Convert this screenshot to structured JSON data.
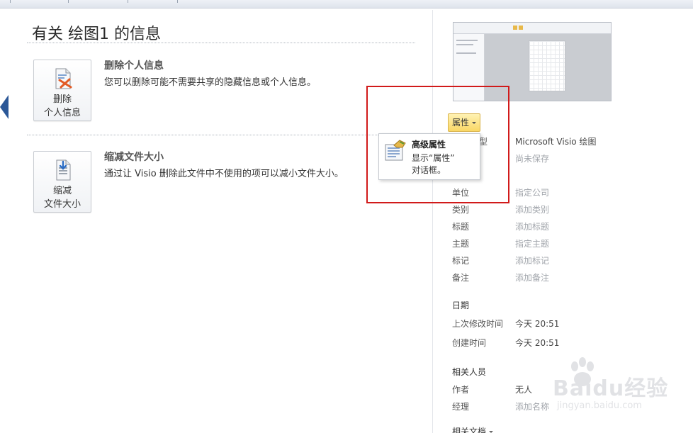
{
  "page": {
    "title": "有关 绘图1 的信息"
  },
  "sections": [
    {
      "button_line1": "删除",
      "button_line2": "个人信息",
      "heading": "删除个人信息",
      "description": "您可以删除可能不需要共享的隐藏信息或个人信息。",
      "icon": "remove-personal-info-icon"
    },
    {
      "button_line1": "缩减",
      "button_line2": "文件大小",
      "heading": "缩减文件大小",
      "description": "通过让 Visio 删除此文件中不使用的项可以减小文件大小。",
      "icon": "reduce-file-size-icon"
    }
  ],
  "properties_button": {
    "label": "属性"
  },
  "popup": {
    "title": "高级属性",
    "line1": "显示“属性”",
    "line2": "对话框。",
    "icon": "advanced-properties-icon"
  },
  "properties": [
    {
      "label": "型",
      "value": "Microsoft Visio 绘图",
      "dark": true
    },
    {
      "label": "",
      "value": "尚未保存",
      "dark": false
    },
    {
      "label": "单位",
      "value": "指定公司",
      "dark": false
    },
    {
      "label": "类别",
      "value": "添加类别",
      "dark": false
    },
    {
      "label": "标题",
      "value": "添加标题",
      "dark": false
    },
    {
      "label": "主题",
      "value": "指定主题",
      "dark": false
    },
    {
      "label": "标记",
      "value": "添加标记",
      "dark": false
    },
    {
      "label": "备注",
      "value": "添加备注",
      "dark": false
    }
  ],
  "dates": {
    "heading": "日期",
    "rows": [
      {
        "label": "上次修改时间",
        "value": "今天 20:51"
      },
      {
        "label": "创建时间",
        "value": "今天 20:51"
      }
    ]
  },
  "people": {
    "heading": "相关人员",
    "rows": [
      {
        "label": "作者",
        "value": "无人"
      },
      {
        "label": "经理",
        "value": "添加名称"
      }
    ]
  },
  "related_docs": {
    "heading": "相关文档"
  },
  "watermark": {
    "text": "Baidu经验",
    "url": "jingyan.baidu.com"
  },
  "colors": {
    "accent": "#2b5797",
    "highlight_border": "#d11a1a",
    "properties_button": "#f9d765"
  }
}
